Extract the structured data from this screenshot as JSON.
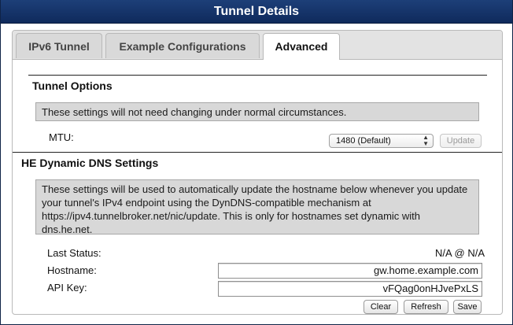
{
  "window": {
    "title": "Tunnel Details"
  },
  "tabs": [
    {
      "label": "IPv6 Tunnel",
      "active": false
    },
    {
      "label": "Example Configurations",
      "active": false
    },
    {
      "label": "Advanced",
      "active": true
    }
  ],
  "tunnel_options": {
    "title": "Tunnel Options",
    "note": "These settings will not need changing under normal circumstances.",
    "mtu_label": "MTU:",
    "mtu_selected": "1480 (Default)",
    "update_button": "Update"
  },
  "ddns": {
    "title": "HE Dynamic DNS Settings",
    "note": "These settings will be used to automatically update the hostname below whenever you update your tunnel's IPv4 endpoint using the DynDNS-compatible mechanism at https://ipv4.tunnelbroker.net/nic/update. This is only for hostnames set dynamic with dns.he.net.",
    "last_status_label": "Last Status:",
    "last_status_value": "N/A @ N/A",
    "hostname_label": "Hostname:",
    "hostname_value": "gw.home.example.com",
    "api_key_label": "API Key:",
    "api_key_value": "vFQag0onHJvePxLS",
    "clear_button": "Clear",
    "refresh_button": "Refresh",
    "save_button": "Save"
  },
  "colors": {
    "titlebar": "#163468",
    "note_background": "#d8d8d8",
    "tab_strip": "#e3e3e3"
  }
}
